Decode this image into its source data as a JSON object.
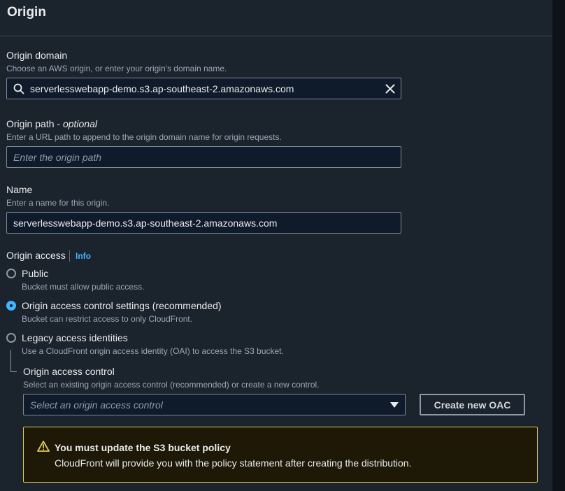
{
  "section": {
    "title": "Origin"
  },
  "origin_domain": {
    "label": "Origin domain",
    "description": "Choose an AWS origin, or enter your origin's domain name.",
    "value": "serverlesswebapp-demo.s3.ap-southeast-2.amazonaws.com",
    "icon": "search-icon",
    "clear_icon": "close-icon"
  },
  "origin_path": {
    "label": "Origin path - ",
    "label_optional": "optional",
    "description": "Enter a URL path to append to the origin domain name for origin requests.",
    "placeholder": "Enter the origin path",
    "value": ""
  },
  "name": {
    "label": "Name",
    "description": "Enter a name for this origin.",
    "value": "serverlesswebapp-demo.s3.ap-southeast-2.amazonaws.com"
  },
  "origin_access": {
    "label": "Origin access",
    "info": "Info",
    "options": [
      {
        "label": "Public",
        "description": "Bucket must allow public access.",
        "selected": false
      },
      {
        "label": "Origin access control settings (recommended)",
        "description": "Bucket can restrict access to only CloudFront.",
        "selected": true
      },
      {
        "label": "Legacy access identities",
        "description": "Use a CloudFront origin access identity (OAI) to access the S3 bucket.",
        "selected": false
      }
    ]
  },
  "origin_access_control": {
    "label": "Origin access control",
    "description": "Select an existing origin access control (recommended) or create a new control.",
    "select_placeholder": "Select an origin access control",
    "create_button": "Create new OAC"
  },
  "alert": {
    "title": "You must update the S3 bucket policy",
    "text": "CloudFront will provide you with the policy statement after creating the distribution.",
    "icon": "warning-icon"
  },
  "colors": {
    "accent": "#42b4ff",
    "warning_border": "#e0ca57",
    "background": "#1b232d"
  }
}
